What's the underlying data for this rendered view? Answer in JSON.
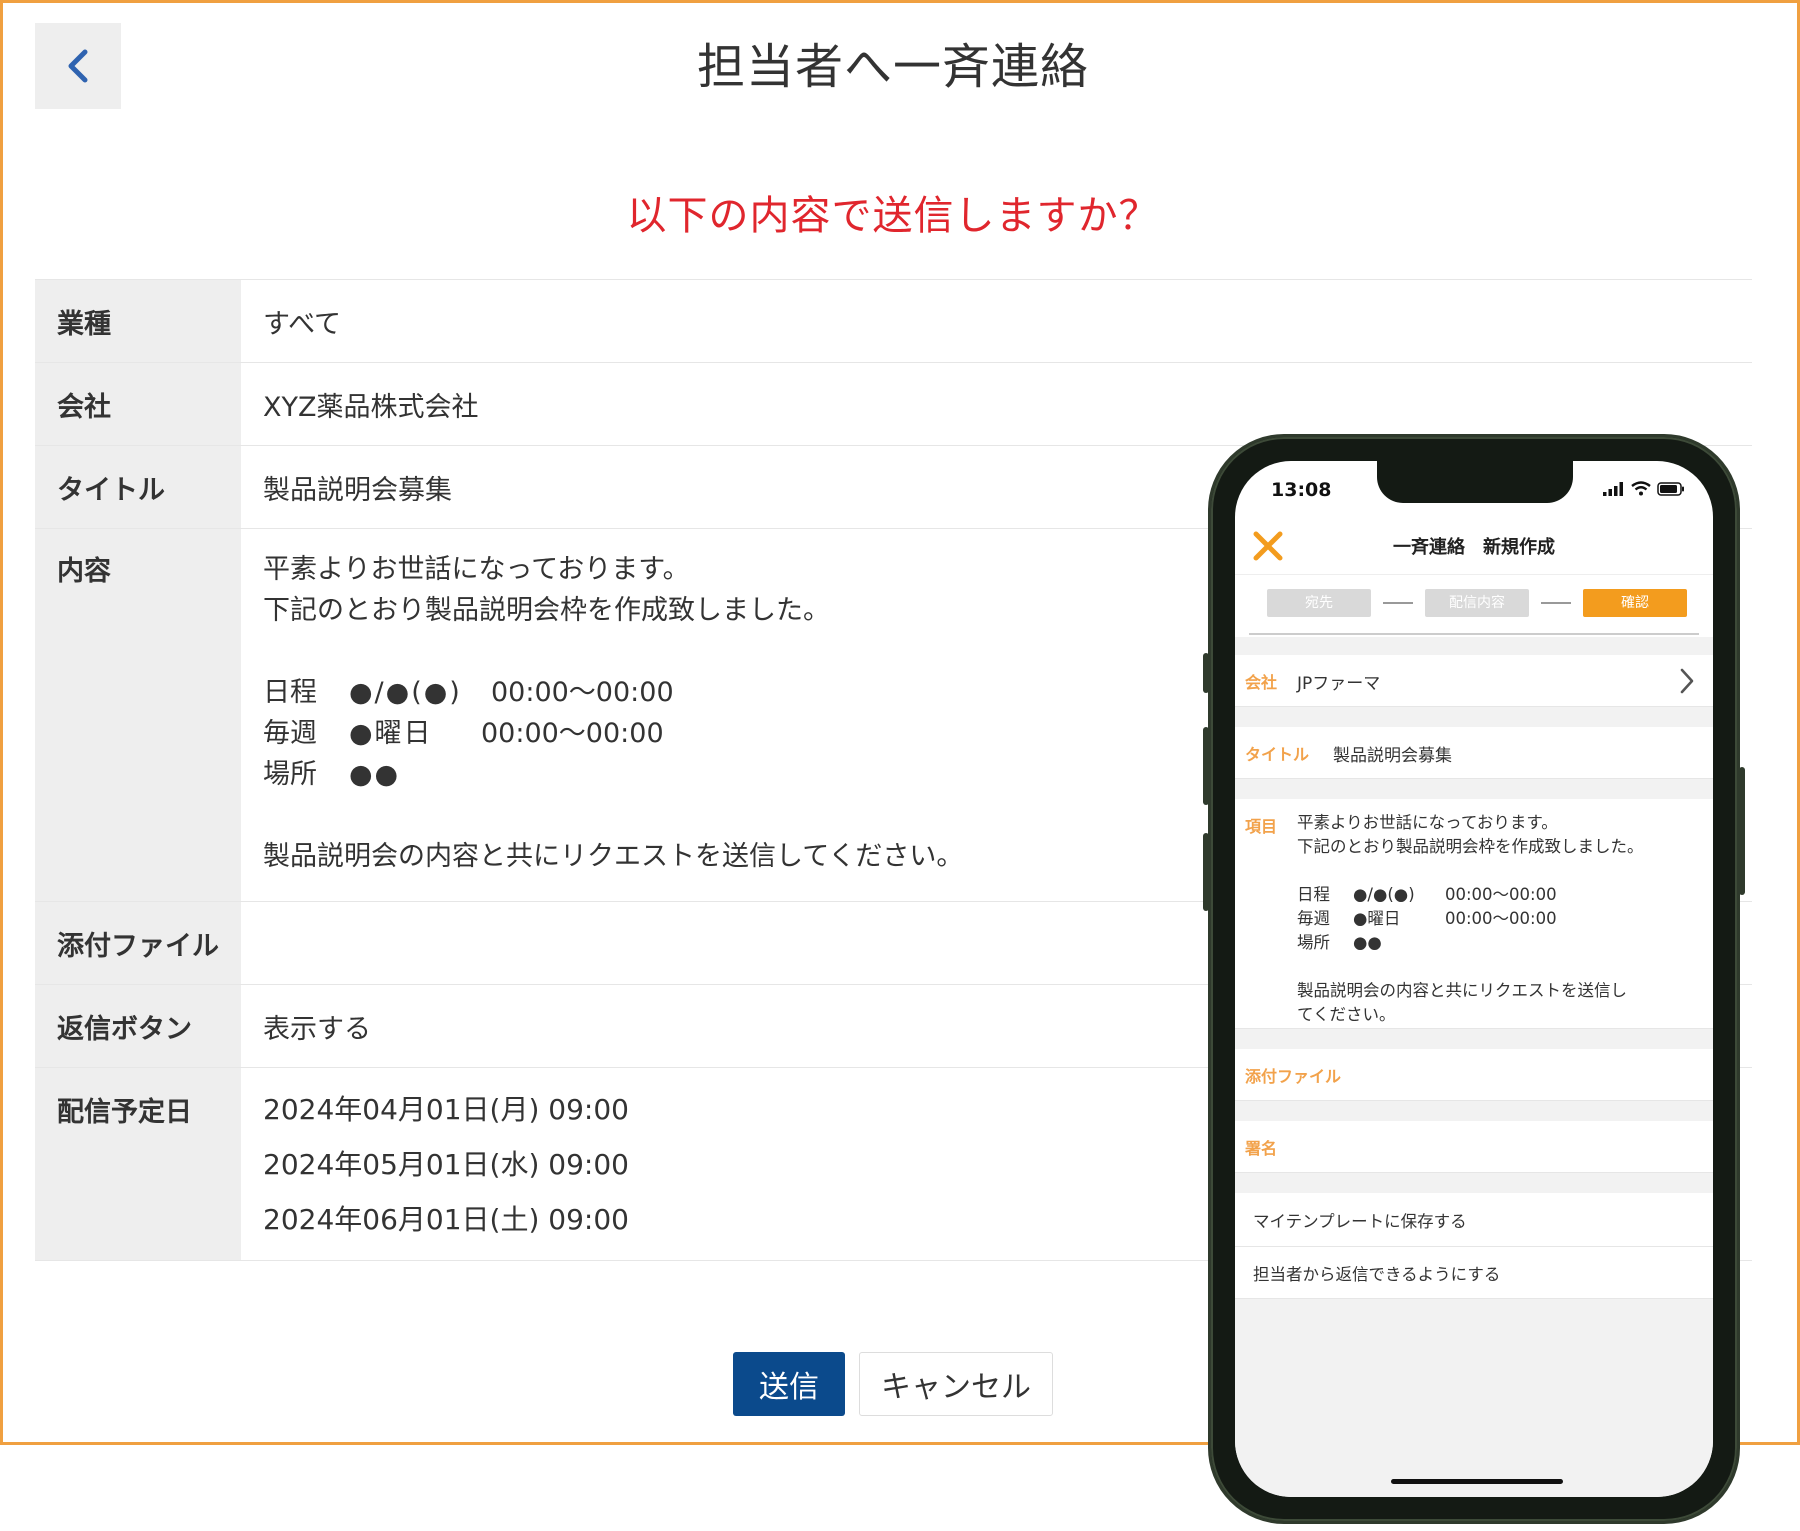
{
  "header": {
    "back_icon": "chevron-left-icon",
    "title": "担当者へ一斉連絡"
  },
  "confirm": {
    "question": "以下の内容で送信しますか？"
  },
  "table": {
    "rows": {
      "industry": {
        "label": "業種",
        "value": "すべて"
      },
      "company": {
        "label": "会社",
        "value": "XYZ薬品株式会社"
      },
      "title": {
        "label": "タイトル",
        "value": "製品説明会募集"
      },
      "content": {
        "label": "内容",
        "line1": "平素よりお世話になっております。",
        "line2": "下記のとおり製品説明会枠を作成致しました。",
        "schedule": [
          {
            "k": "日程",
            "v": "●/●(●)",
            "t": "00:00〜00:00"
          },
          {
            "k": "毎週",
            "v": "●曜日",
            "t": "00:00〜00:00"
          },
          {
            "k": "場所",
            "v": "●●",
            "t": ""
          }
        ],
        "line3": "製品説明会の内容と共にリクエストを送信してください。"
      },
      "attachment": {
        "label": "添付ファイル",
        "value": ""
      },
      "reply": {
        "label": "返信ボタン",
        "value": "表示する"
      },
      "delivery": {
        "label": "配信予定日",
        "dates": [
          "2024年04月01日(月) 09:00",
          "2024年05月01日(水) 09:00",
          "2024年06月01日(土) 09:00"
        ]
      }
    }
  },
  "buttons": {
    "send": "送信",
    "cancel": "キャンセル"
  },
  "phone": {
    "status_time": "13:08",
    "app_title": "一斉連絡　新規作成",
    "steps": {
      "step1": "宛先",
      "step2": "配信内容",
      "step3": "確認"
    },
    "company": {
      "label": "会社",
      "value": "JPファーマ"
    },
    "title": {
      "label": "タイトル",
      "value": "製品説明会募集"
    },
    "item": {
      "label": "項目",
      "line1": "平素よりお世話になっております。",
      "line2": "下記のとおり製品説明会枠を作成致しました。",
      "schedule": [
        {
          "k": "日程",
          "v": "●/●(●)",
          "t": "00:00～00:00"
        },
        {
          "k": "毎週",
          "v": "●曜日",
          "t": "00:00～00:00"
        },
        {
          "k": "場所",
          "v": "●●",
          "t": ""
        }
      ],
      "line3": "製品説明会の内容と共にリクエストを送信し",
      "line4": "てください。"
    },
    "attachment_label": "添付ファイル",
    "signature_label": "署名",
    "save_template": "マイテンプレートに保存する",
    "allow_reply": "担当者から返信できるようにする"
  },
  "colors": {
    "frame_border": "#f0a040",
    "question_red": "#e0262d",
    "send_blue": "#0b4a8c",
    "phone_orange": "#f39c1e",
    "phone_label": "#f2a24b"
  }
}
